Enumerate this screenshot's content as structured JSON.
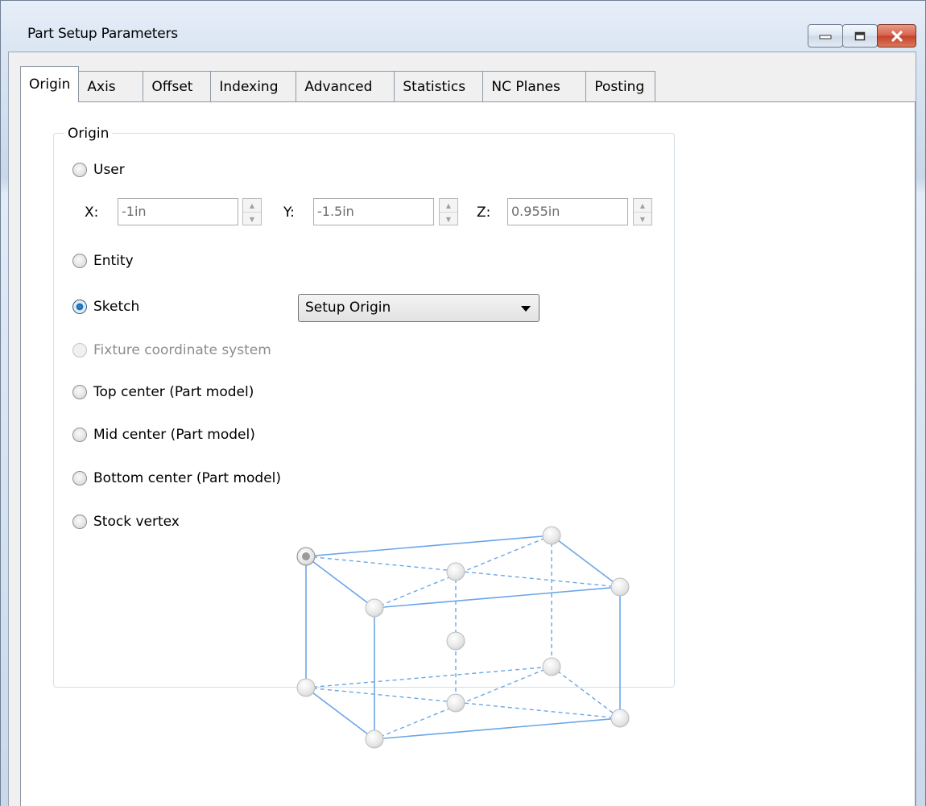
{
  "window": {
    "title": "Part Setup Parameters"
  },
  "window_buttons": [
    "minimize-icon",
    "restore-icon",
    "close-icon"
  ],
  "tabs": [
    {
      "label": "Origin",
      "active": true
    },
    {
      "label": "Axis"
    },
    {
      "label": "Offset"
    },
    {
      "label": "Indexing"
    },
    {
      "label": "Advanced"
    },
    {
      "label": "Statistics"
    },
    {
      "label": "NC Planes"
    },
    {
      "label": "Posting"
    }
  ],
  "origin_group": {
    "title": "Origin",
    "options": {
      "user": "User",
      "entity": "Entity",
      "sketch": "Sketch",
      "fixture": "Fixture coordinate system",
      "top_center": "Top center (Part model)",
      "mid_center": "Mid center (Part model)",
      "bottom_center": "Bottom center (Part model)",
      "stock_vertex": "Stock vertex"
    },
    "selected": "sketch",
    "disabled": [
      "fixture"
    ],
    "coords": {
      "x_label": "X:",
      "x_value": "-1in",
      "y_label": "Y:",
      "y_value": "-1.5in",
      "z_label": "Z:",
      "z_value": "0.955in"
    },
    "sketch_dropdown": "Setup Origin"
  },
  "colors": {
    "cube_line": "#6aa6e8",
    "selected_radio": "#1565b1"
  }
}
